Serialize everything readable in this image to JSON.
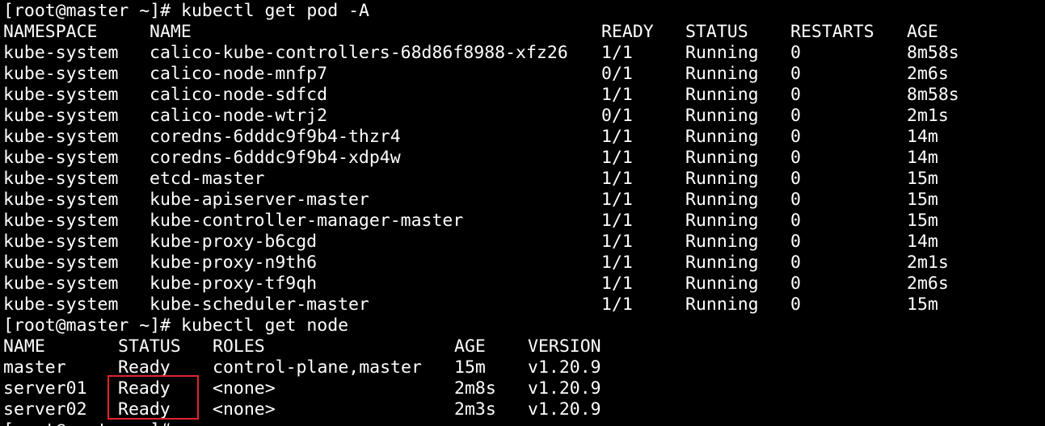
{
  "terminal": {
    "prompt": "[root@master ~]#",
    "colors": {
      "background": "#000000",
      "text": "#ffffff",
      "highlight_box": "#e0242c"
    },
    "pods_command": "kubectl get pod -A",
    "pods_headers": [
      "NAMESPACE",
      "NAME",
      "READY",
      "STATUS",
      "RESTARTS",
      "AGE"
    ],
    "pods_rows": [
      [
        "kube-system",
        "calico-kube-controllers-68d86f8988-xfz26",
        "1/1",
        "Running",
        "0",
        "8m58s"
      ],
      [
        "kube-system",
        "calico-node-mnfp7",
        "0/1",
        "Running",
        "0",
        "2m6s"
      ],
      [
        "kube-system",
        "calico-node-sdfcd",
        "1/1",
        "Running",
        "0",
        "8m58s"
      ],
      [
        "kube-system",
        "calico-node-wtrj2",
        "0/1",
        "Running",
        "0",
        "2m1s"
      ],
      [
        "kube-system",
        "coredns-6dddc9f9b4-thzr4",
        "1/1",
        "Running",
        "0",
        "14m"
      ],
      [
        "kube-system",
        "coredns-6dddc9f9b4-xdp4w",
        "1/1",
        "Running",
        "0",
        "14m"
      ],
      [
        "kube-system",
        "etcd-master",
        "1/1",
        "Running",
        "0",
        "15m"
      ],
      [
        "kube-system",
        "kube-apiserver-master",
        "1/1",
        "Running",
        "0",
        "15m"
      ],
      [
        "kube-system",
        "kube-controller-manager-master",
        "1/1",
        "Running",
        "0",
        "15m"
      ],
      [
        "kube-system",
        "kube-proxy-b6cgd",
        "1/1",
        "Running",
        "0",
        "14m"
      ],
      [
        "kube-system",
        "kube-proxy-n9th6",
        "1/1",
        "Running",
        "0",
        "2m1s"
      ],
      [
        "kube-system",
        "kube-proxy-tf9qh",
        "1/1",
        "Running",
        "0",
        "2m6s"
      ],
      [
        "kube-system",
        "kube-scheduler-master",
        "1/1",
        "Running",
        "0",
        "15m"
      ]
    ],
    "nodes_command": "kubectl get node",
    "nodes_headers": [
      "NAME",
      "STATUS",
      "ROLES",
      "AGE",
      "VERSION"
    ],
    "nodes_rows": [
      [
        "master",
        "Ready",
        "control-plane,master",
        "15m",
        "v1.20.9"
      ],
      [
        "server01",
        "Ready",
        "<none>",
        "2m8s",
        "v1.20.9"
      ],
      [
        "server02",
        "Ready",
        "<none>",
        "2m3s",
        "v1.20.9"
      ]
    ]
  }
}
